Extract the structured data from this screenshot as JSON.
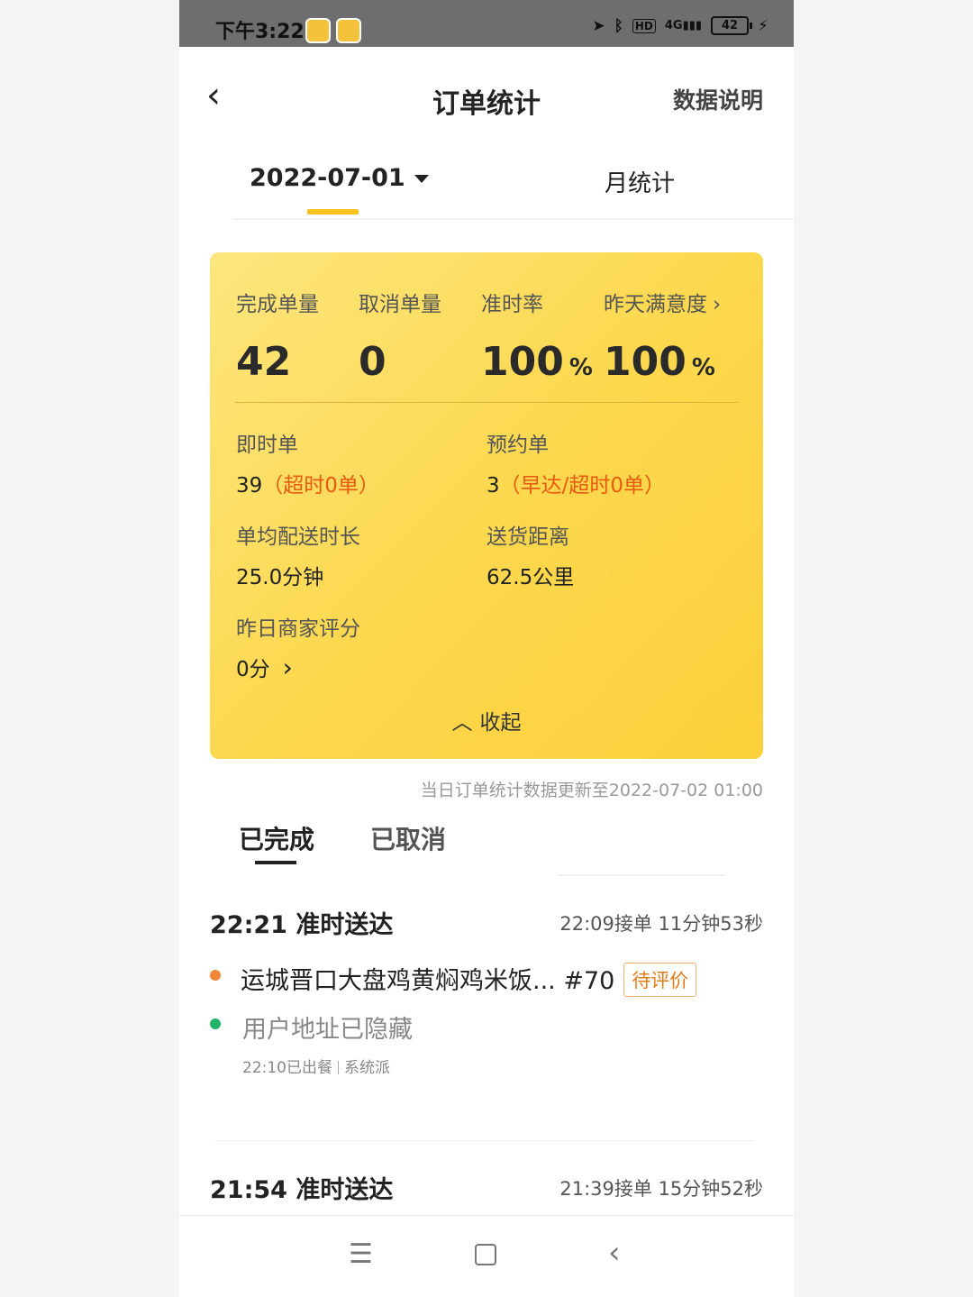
{
  "status_bar": {
    "time": "下午3:22",
    "network": "4G",
    "hd": "HD",
    "battery": "42"
  },
  "header": {
    "title": "订单统计",
    "right_action": "数据说明"
  },
  "date_tabs": {
    "date": "2022-07-01",
    "month": "月统计"
  },
  "summary": {
    "metrics": [
      {
        "label": "完成单量",
        "value": "42",
        "unit": ""
      },
      {
        "label": "取消单量",
        "value": "0",
        "unit": ""
      },
      {
        "label": "准时率",
        "value": "100",
        "unit": "%"
      },
      {
        "label": "昨天满意度",
        "value": "100",
        "unit": "%"
      }
    ],
    "details": {
      "instant_label": "即时单",
      "instant_count": "39",
      "instant_note": "（超时0单）",
      "reserve_label": "预约单",
      "reserve_count": "3",
      "reserve_note": "（早达/超时0单）",
      "avg_time_label": "单均配送时长",
      "avg_time_value": "25.0分钟",
      "distance_label": "送货距离",
      "distance_value": "62.5公里",
      "rating_label": "昨日商家评分",
      "rating_value": "0分"
    },
    "collapse_label": "收起"
  },
  "update_note": "当日订单统计数据更新至2022-07-02 01:00",
  "order_tabs": {
    "completed": "已完成",
    "cancelled": "已取消"
  },
  "orders": [
    {
      "title": "22:21 准时送达",
      "meta": "22:09接单 11分钟53秒",
      "shop": "运城晋口大盘鸡黄焖鸡米饭... #70",
      "badge": "待评价",
      "address": "用户地址已隐藏",
      "sub_time": "22:10已出餐",
      "sub_type": "系统派"
    },
    {
      "title": "21:54 准时送达",
      "meta": "21:39接单 15分钟52秒"
    }
  ],
  "colors": {
    "accent": "#f7c21d",
    "warning": "#e85a10",
    "shop_dot": "#f0883a",
    "addr_dot": "#22b36a"
  }
}
